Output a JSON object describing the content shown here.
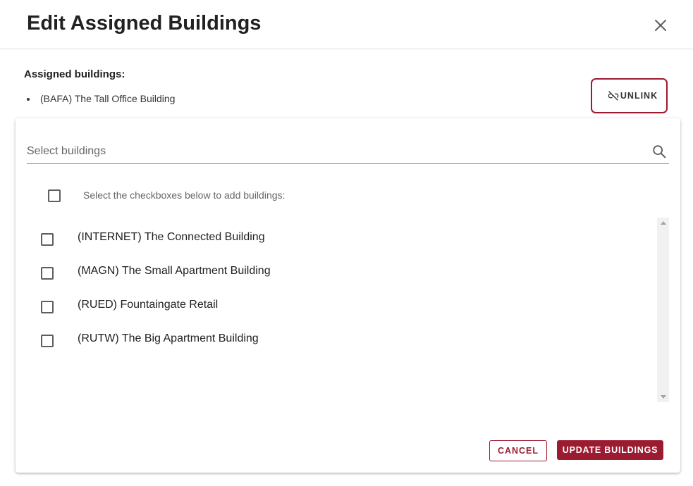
{
  "dialog": {
    "title": "Edit Assigned Buildings",
    "close_icon": "close-icon"
  },
  "assigned": {
    "label": "Assigned buildings:",
    "items": [
      {
        "label": "(BAFA) The Tall Office Building"
      }
    ],
    "unlink_label": "UNLINK",
    "unlink_icon": "link-off-icon"
  },
  "search": {
    "placeholder": "Select buildings",
    "value": "",
    "icon": "search-icon"
  },
  "select_all": {
    "label": "Select the checkboxes below to add buildings:",
    "checked": false
  },
  "buildings": [
    {
      "label": "(INTERNET) The Connected Building",
      "checked": false
    },
    {
      "label": "(MAGN) The Small Apartment Building",
      "checked": false
    },
    {
      "label": "(RUED) Fountaingate Retail",
      "checked": false
    },
    {
      "label": "(RUTW) The Big Apartment Building",
      "checked": false
    }
  ],
  "actions": {
    "cancel_label": "CANCEL",
    "update_label": "UPDATE BUILDINGS"
  },
  "colors": {
    "accent": "#9b1c31",
    "text": "#212121",
    "muted": "#666666"
  }
}
